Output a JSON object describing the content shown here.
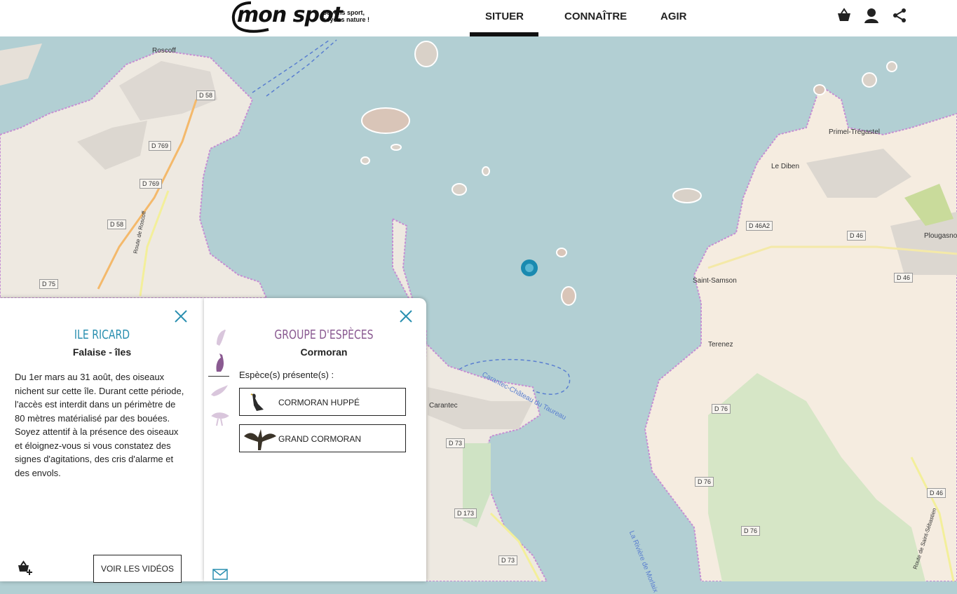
{
  "header": {
    "logo_text": "mon spot",
    "tagline_1": "Soyons sport,",
    "tagline_2": "soyons nature !",
    "nav": [
      "SITUER",
      "CONNAÎTRE",
      "AGIR"
    ],
    "active_nav": "SITUER",
    "icons": [
      "basket-icon",
      "user-icon",
      "share-icon"
    ]
  },
  "map": {
    "places": [
      "Roscoff",
      "Primel-Trégastel",
      "Le Diben",
      "Saint-Samson",
      "Plougasnou",
      "Terenez",
      "Carantec",
      "Carantec-Château du Taureau",
      "La Rivière de Morlaix",
      "Route de Roscoff",
      "Route de Saint-Sébastien"
    ],
    "roads": [
      "D 58",
      "D 769",
      "D 769",
      "D 58",
      "D 75",
      "D 46A2",
      "D 46",
      "D 46",
      "D 76",
      "D 76",
      "D 76",
      "D 73",
      "D 173",
      "D 73",
      "D 46"
    ]
  },
  "site_panel": {
    "title": "ILE RICARD",
    "subtitle": "Falaise - îles",
    "description": "Du 1er mars au 31 août, des oiseaux nichent sur cette île. Durant cette période, l'accès est interdit dans un périmètre de 80 mètres matérialisé par des bouées. Soyez attentif à la présence des oiseaux et éloignez-vous si vous constatez des signes d'agitations, des cris d'alarme et des envols.",
    "videos_button": "VOIR LES VIDÉOS",
    "title_color": "#2a8fb0"
  },
  "species_panel": {
    "title": "GROUPE D'ESPÈCES",
    "subtitle": "Cormoran",
    "present_label": "Espèce(s) présente(s) :",
    "species": [
      "CORMORAN HUPPÉ",
      "GRAND CORMORAN"
    ],
    "title_color": "#8a5a91"
  }
}
